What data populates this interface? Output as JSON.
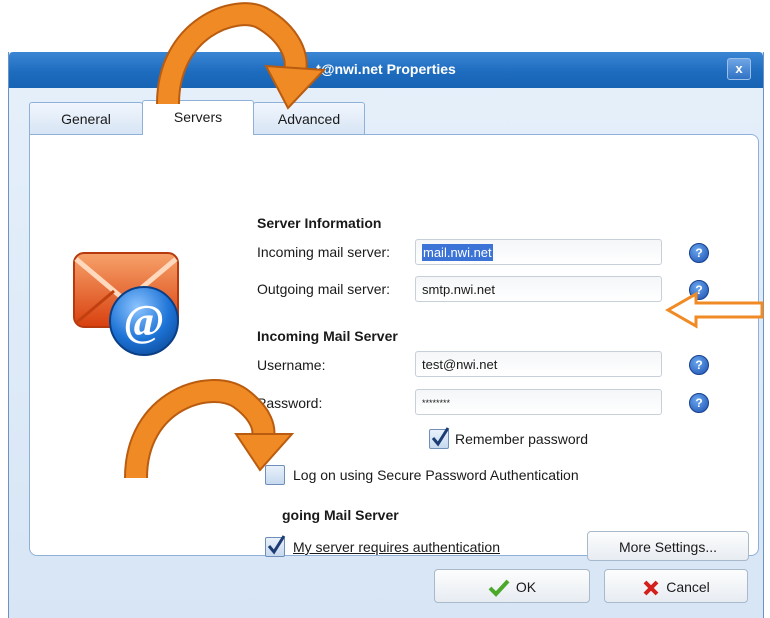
{
  "window": {
    "title": "t@nwi.net Properties",
    "close": "x"
  },
  "tabs": [
    {
      "label": "General"
    },
    {
      "label": "Servers"
    },
    {
      "label": "Advanced"
    }
  ],
  "server_info": {
    "heading": "Server Information",
    "incoming_label": "Incoming mail server:",
    "incoming_value": "mail.nwi.net",
    "outgoing_label": "Outgoing mail server:",
    "outgoing_value": "smtp.nwi.net"
  },
  "incoming": {
    "heading": "Incoming Mail Server",
    "username_label": "Username:",
    "username_value": "test@nwi.net",
    "password_label": "Password:",
    "password_value": "********",
    "remember_label": "Remember password",
    "remember_checked": true,
    "spa_label": "Log on using Secure Password Authentication",
    "spa_checked": false
  },
  "outgoing": {
    "heading": "going Mail Server",
    "auth_label": "My server requires authentication",
    "auth_checked": true,
    "more_settings": "More Settings..."
  },
  "footer": {
    "ok": "OK",
    "cancel": "Cancel"
  },
  "help_glyph": "?",
  "colors": {
    "annotation_arrow": "#f08a24",
    "titlebar": "#1e6cbf",
    "envelope": "#e8581c",
    "at_badge": "#1d73d6"
  },
  "icons": [
    "mail-account-icon",
    "help-icon",
    "checkmark-icon",
    "cancel-x-icon",
    "close-icon"
  ]
}
